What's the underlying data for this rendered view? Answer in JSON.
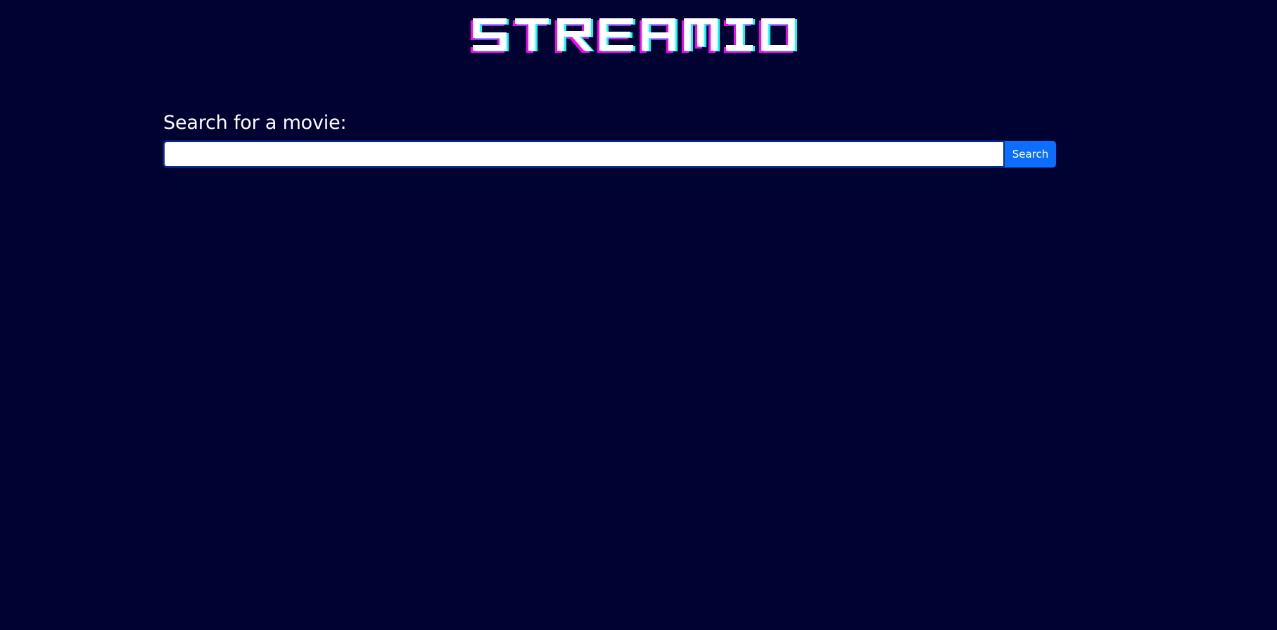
{
  "header": {
    "logo_text": "STREAMIO"
  },
  "search": {
    "label": "Search for a movie:",
    "value": "",
    "placeholder": "",
    "button_label": "Search"
  },
  "colors": {
    "background": "#000331",
    "logo_fill": "#ffffff",
    "logo_shadow_magenta": "#ff00ff",
    "logo_shadow_cyan": "#00ffff",
    "button": "#0d6efd",
    "input_border": "#0a2d8c"
  }
}
